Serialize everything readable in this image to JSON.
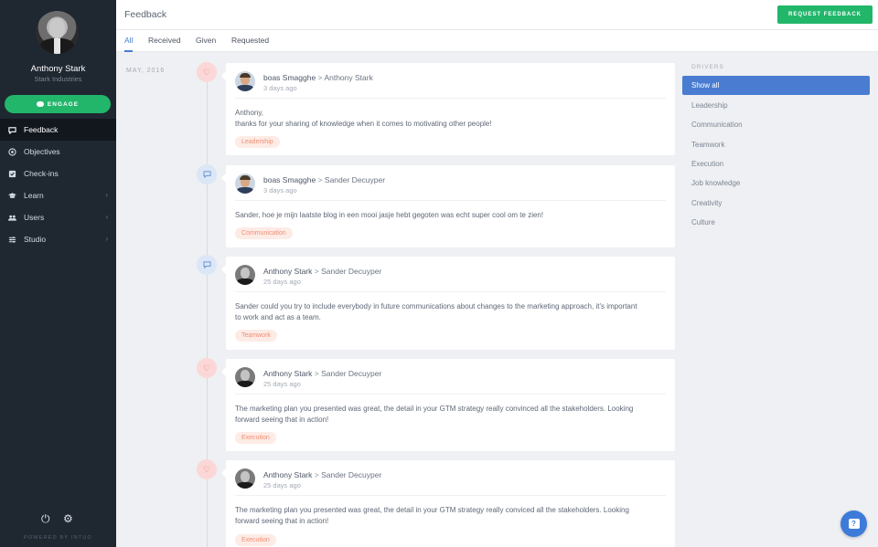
{
  "sidebar": {
    "user_name": "Anthony Stark",
    "company": "Stark Industries",
    "engage_label": "ENGAGE",
    "items": [
      {
        "label": "Feedback",
        "icon": "chat-bubble-icon"
      },
      {
        "label": "Objectives",
        "icon": "target-icon"
      },
      {
        "label": "Check-ins",
        "icon": "checkbox-icon"
      },
      {
        "label": "Learn",
        "icon": "graduation-cap-icon"
      },
      {
        "label": "Users",
        "icon": "users-icon"
      },
      {
        "label": "Studio",
        "icon": "sliders-icon"
      }
    ],
    "powered_by": "POWERED BY INTUO"
  },
  "header": {
    "title": "Feedback",
    "request_button": "REQUEST FEEDBACK"
  },
  "tabs": [
    "All",
    "Received",
    "Given",
    "Requested"
  ],
  "timeline": {
    "date_label": "MAY, 2016",
    "items": [
      {
        "type": "heart",
        "author": "boas Smagghe",
        "separator": ">",
        "recipient": "Anthony Stark",
        "time": "3 days ago",
        "body_line1": "Anthony,",
        "body_line2": "thanks for your sharing of knowledge when it comes to motivating other people!",
        "tag": "Leadership"
      },
      {
        "type": "chat",
        "author": "boas Smagghe",
        "separator": ">",
        "recipient": "Sander Decuyper",
        "time": "3 days ago",
        "body_line1": "Sander, hoe je mijn laatste blog in een mooi jasje hebt gegoten was echt super cool om te zien!",
        "body_line2": "",
        "tag": "Communication"
      },
      {
        "type": "chat",
        "author": "Anthony Stark",
        "separator": ">",
        "recipient": "Sander Decuyper",
        "time": "25 days ago",
        "body_line1": "Sander could you try to include everybody in future communications about changes to the marketing approach, it's important",
        "body_line2": "to work and act as a team.",
        "tag": "Teamwork"
      },
      {
        "type": "heart",
        "author": "Anthony Stark",
        "separator": ">",
        "recipient": "Sander Decuyper",
        "time": "25 days ago",
        "body_line1": "The marketing plan you presented was great, the detail in your GTM strategy really convinced all the stakeholders. Looking",
        "body_line2": "forward seeing that in action!",
        "tag": "Execution"
      },
      {
        "type": "heart",
        "author": "Anthony Stark",
        "separator": ">",
        "recipient": "Sander Decuyper",
        "time": "25 days ago",
        "body_line1": "The marketing plan you presented was great, the detail in your GTM strategy really conviced all the stakeholders. Looking",
        "body_line2": "forward seeing that in action!",
        "tag": "Execution"
      }
    ]
  },
  "drivers": {
    "title": "DRIVERS",
    "items": [
      "Show all",
      "Leadership",
      "Communication",
      "Teamwork",
      "Execution",
      "Job knowledge",
      "Creativity",
      "Culture"
    ]
  },
  "colors": {
    "accent_green": "#22b66b",
    "accent_blue": "#4a7dd1",
    "sidebar_bg": "#1f2731",
    "tag_text": "#ef8f72"
  }
}
